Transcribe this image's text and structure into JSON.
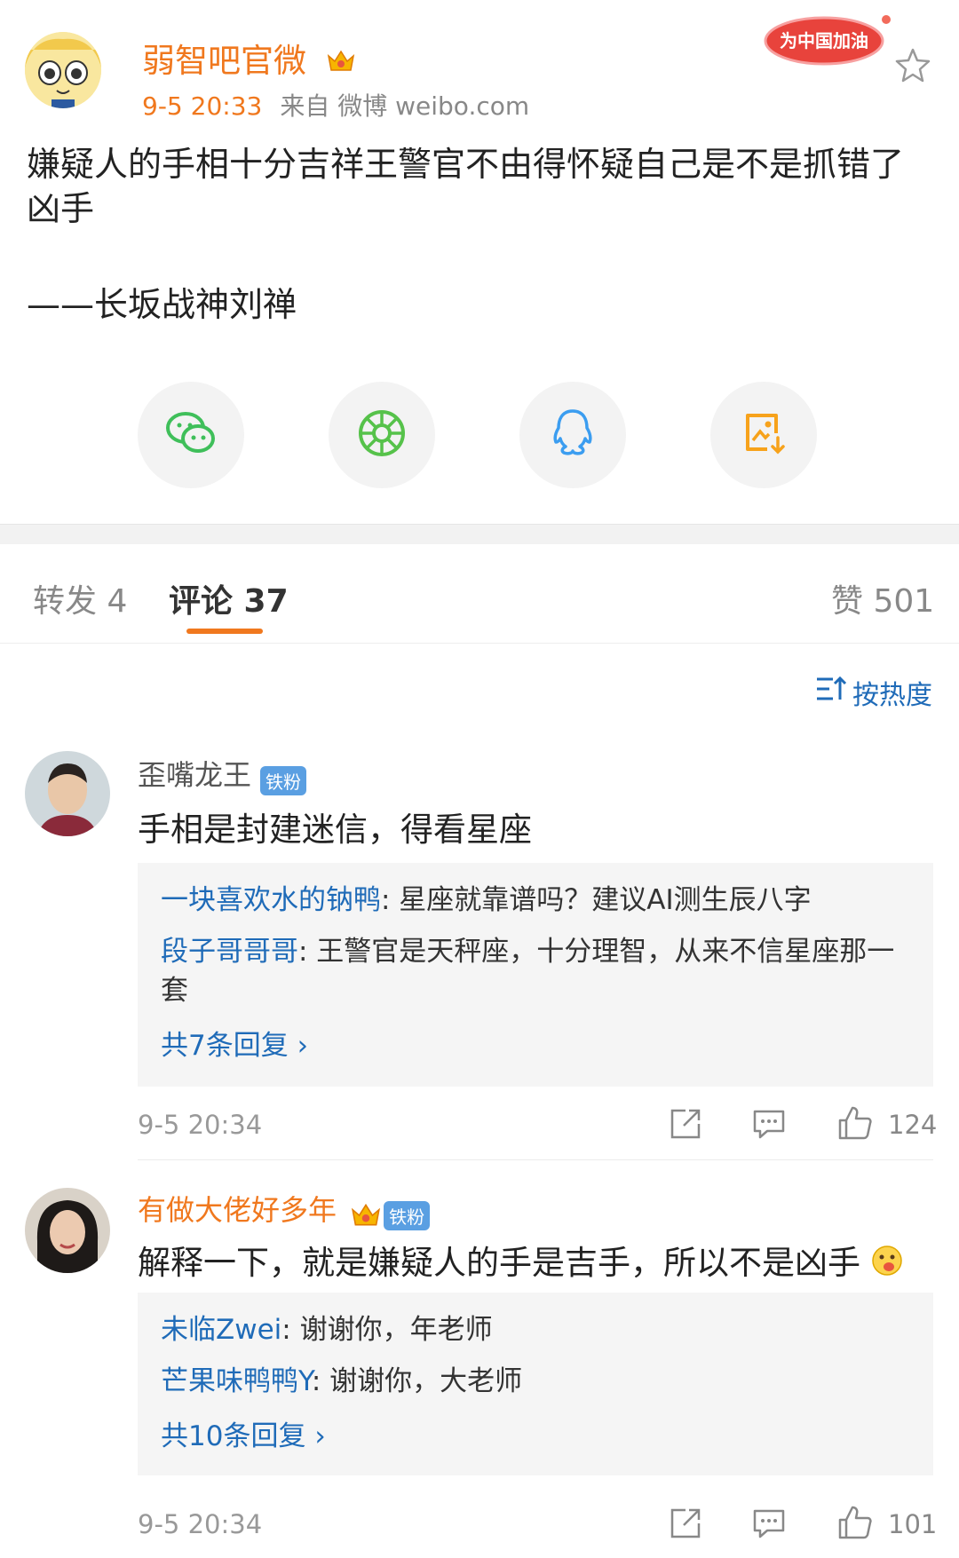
{
  "post": {
    "author": "弱智吧官微",
    "time": "9-5 20:33",
    "source": "来自 微博 weibo.com",
    "badge": "为中国加油",
    "text": "嫌疑人的手相十分吉祥王警官不由得怀疑自己是不是抓错了凶手",
    "signature": "——长坂战神刘禅"
  },
  "share": {
    "items": [
      {
        "icon": "wechat-icon"
      },
      {
        "icon": "moments-icon"
      },
      {
        "icon": "qq-icon"
      },
      {
        "icon": "save-image-icon"
      }
    ]
  },
  "tabs": {
    "repost": "转发 4",
    "comment": "评论 37",
    "like": "赞 501"
  },
  "sort_label": "按热度",
  "comments": [
    {
      "name": "歪嘴龙王",
      "badge": "铁粉",
      "text": "手相是封建迷信，得看星座",
      "replies": [
        {
          "name": "一块喜欢水的钠鸭",
          "text": ": 星座就靠谱吗？建议AI测生辰八字"
        },
        {
          "name": "段子哥哥哥",
          "text": ": 王警官是天秤座，十分理智，从来不信星座那一套"
        }
      ],
      "more": "共7条回复",
      "time": "9-5 20:34",
      "likes": "124"
    },
    {
      "name": "有做大佬好多年",
      "badge": "铁粉",
      "text": "解释一下，就是嫌疑人的手是吉手，所以不是凶手",
      "replies": [
        {
          "name": "未临Zwei",
          "text": ": 谢谢你，年老师"
        },
        {
          "name": "芒果味鸭鸭Y",
          "text": ": 谢谢你，大老师"
        }
      ],
      "more": "共10条回复",
      "time": "9-5 20:34",
      "likes": "101"
    }
  ],
  "colors": {
    "accent": "#f0781e",
    "link": "#1f6bb8",
    "wechat": "#3fbf5a",
    "moments": "#56c24a",
    "qq": "#3b9df0",
    "save": "#f7a21b"
  }
}
